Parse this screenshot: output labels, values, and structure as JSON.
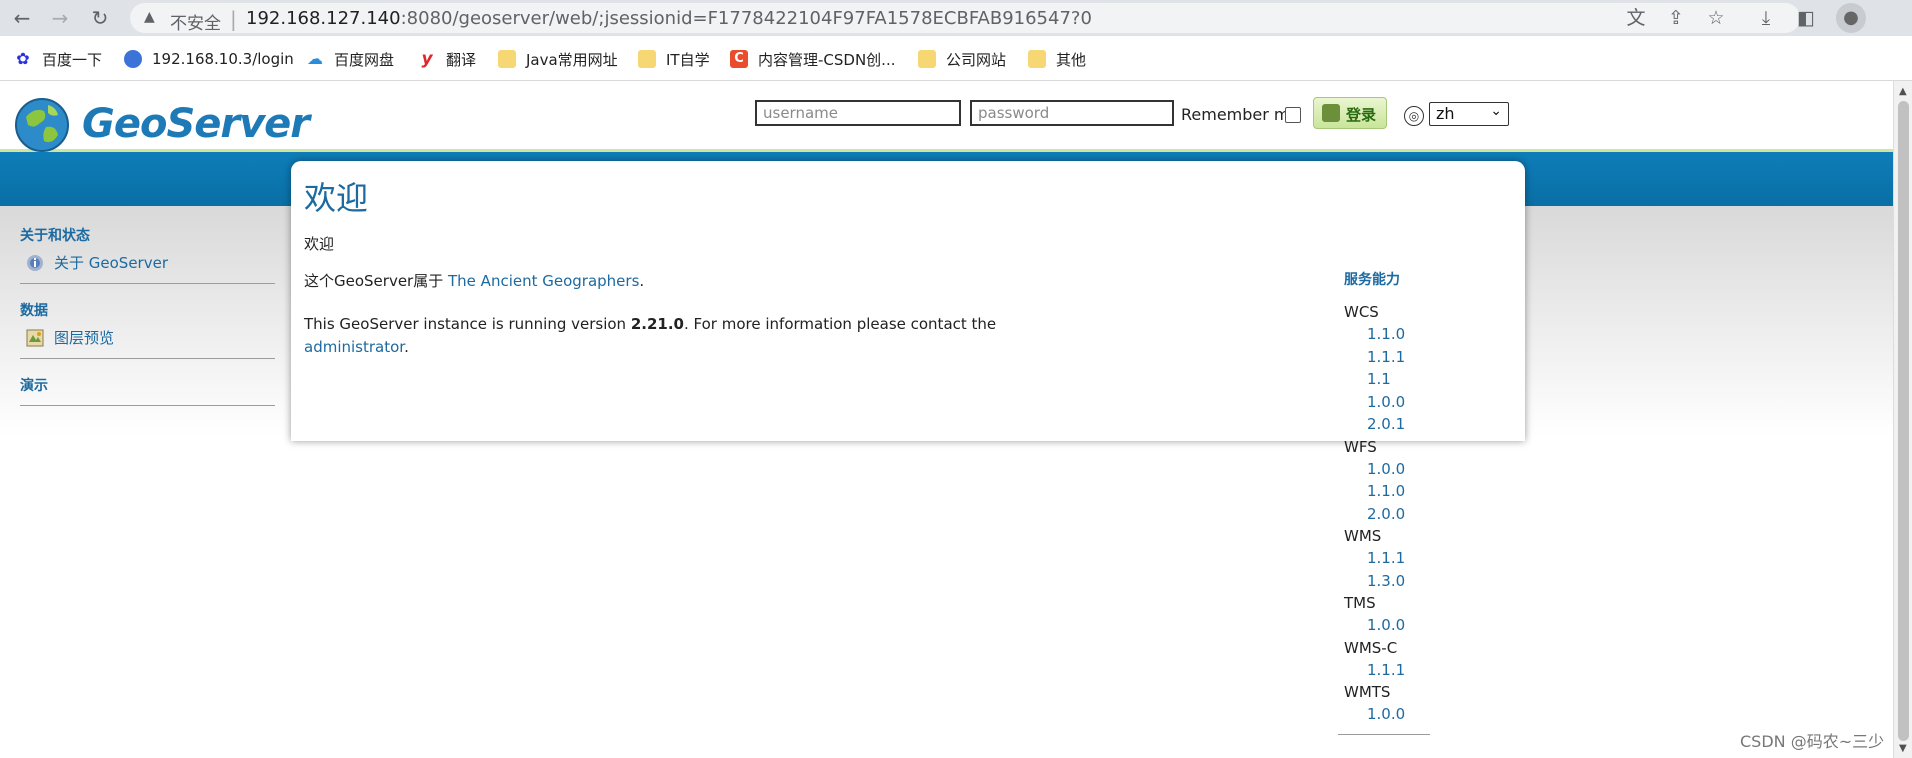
{
  "browser": {
    "url_warning": "不安全",
    "url_host": "192.168.127.140",
    "url_rest": ":8080/geoserver/web/;jsessionid=F1778422104F97FA1578ECBFAB916547?0"
  },
  "bookmarks": [
    {
      "label": "百度一下",
      "icon": "paw-icon",
      "color": "#2932e1"
    },
    {
      "label": "192.168.10.3/login",
      "icon": "globe-icon",
      "color": "#3b73d9"
    },
    {
      "label": "百度网盘",
      "icon": "cloud-icon",
      "color": "#2a8cdc"
    },
    {
      "label": "翻译",
      "icon": "youdao-icon",
      "color": "#e0262b"
    },
    {
      "label": "Java常用网址",
      "icon": "folder-icon"
    },
    {
      "label": "IT自学",
      "icon": "folder-icon"
    },
    {
      "label": "内容管理-CSDN创...",
      "icon": "csdn-icon",
      "color": "#e94d2e"
    },
    {
      "label": "公司网站",
      "icon": "folder-icon"
    },
    {
      "label": "其他",
      "icon": "folder-icon"
    }
  ],
  "header": {
    "logo_text": "GeoServer",
    "username_placeholder": "username",
    "password_placeholder": "password",
    "remember_label": "Remember me",
    "login_label": "登录",
    "lang_value": "zh"
  },
  "sidebar": {
    "sections": [
      {
        "title": "关于和状态",
        "items": [
          {
            "label": "关于 GeoServer",
            "icon": "info-icon"
          }
        ]
      },
      {
        "title": "数据",
        "items": [
          {
            "label": "图层预览",
            "icon": "map-icon"
          }
        ]
      },
      {
        "title": "演示",
        "items": []
      }
    ]
  },
  "main": {
    "title": "欢迎",
    "subtitle": "欢迎",
    "owner_prefix": "这个GeoServer属于",
    "owner_link": "The Ancient Geographers",
    "owner_suffix": ".",
    "version_prefix": "This GeoServer instance is running version",
    "version": "2.21.0",
    "version_suffix": ". For more information please contact the",
    "admin_link": "administrator",
    "admin_suffix": "."
  },
  "capabilities": {
    "title": "服务能力",
    "services": [
      {
        "name": "WCS",
        "versions": [
          "1.1.0",
          "1.1.1",
          "1.1",
          "1.0.0",
          "2.0.1"
        ]
      },
      {
        "name": "WFS",
        "versions": [
          "1.0.0",
          "1.1.0",
          "2.0.0"
        ]
      },
      {
        "name": "WMS",
        "versions": [
          "1.1.1",
          "1.3.0"
        ]
      },
      {
        "name": "TMS",
        "versions": [
          "1.0.0"
        ]
      },
      {
        "name": "WMS-C",
        "versions": [
          "1.1.1"
        ]
      },
      {
        "name": "WMTS",
        "versions": [
          "1.0.0"
        ]
      }
    ]
  },
  "watermark": "CSDN @码农~三少"
}
